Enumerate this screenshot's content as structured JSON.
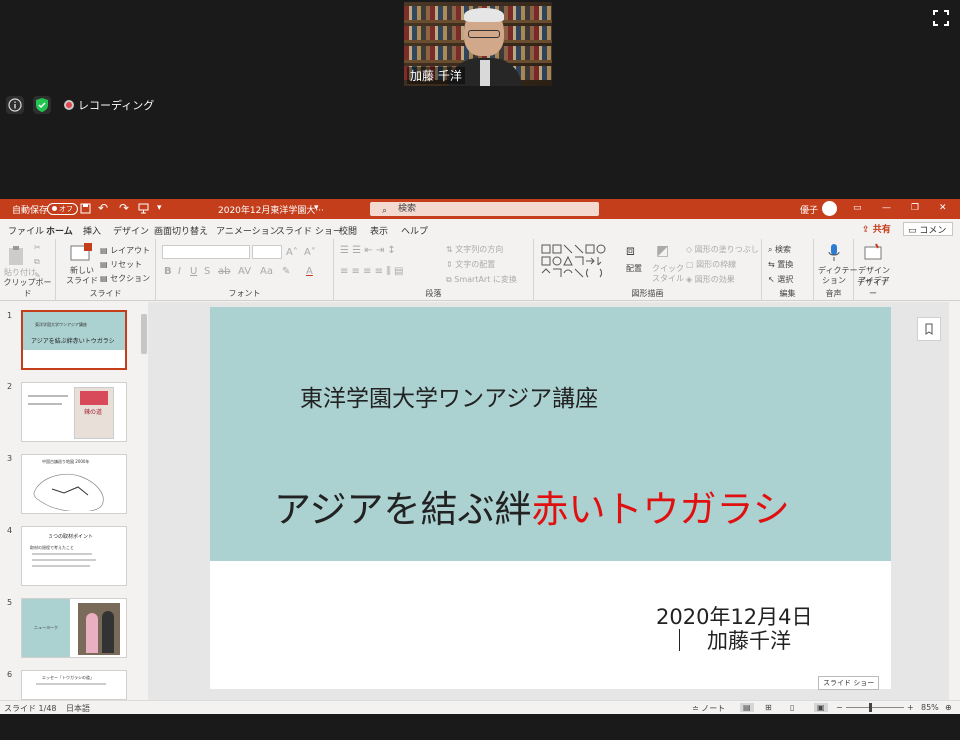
{
  "zoom": {
    "participant_name": "加藤 千洋",
    "recording_label": "レコーディング"
  },
  "titlebar": {
    "autosave_label": "自動保存",
    "autosave_toggle": "オフ",
    "document_title": "2020年12月東洋学園大···",
    "search_placeholder": "検索",
    "user_name": "優子"
  },
  "tabs": [
    "ファイル",
    "ホーム",
    "挿入",
    "デザイン",
    "画面切り替え",
    "アニメーション",
    "スライド ショー",
    "校閲",
    "表示",
    "ヘルプ"
  ],
  "share_label": "共有",
  "comment_label": "コメント",
  "ribbon": {
    "clipboard": {
      "paste": "貼り付け",
      "label": "クリップボード"
    },
    "slides": {
      "new_slide_1": "新しい",
      "new_slide_2": "スライド",
      "layout": "レイアウト",
      "reset": "リセット",
      "section": "セクション",
      "label": "スライド"
    },
    "font": {
      "label": "フォント"
    },
    "paragraph": {
      "text_direction": "文字列の方向",
      "align_text": "文字の配置",
      "smartart": "SmartArt に変換",
      "label": "段落"
    },
    "drawing": {
      "arrange": "配置",
      "quick_style_1": "クイック",
      "quick_style_2": "スタイル",
      "fill": "図形の塗りつぶし",
      "outline": "図形の枠線",
      "effects": "図形の効果",
      "label": "図形描画"
    },
    "editing": {
      "find": "検索",
      "replace": "置換",
      "select": "選択",
      "label": "編集"
    },
    "voice": {
      "dictate_1": "ディクテー",
      "dictate_2": "ション",
      "label": "音声"
    },
    "designer": {
      "ideas_1": "デザイン",
      "ideas_2": "アイデア",
      "label": "デザイナー"
    }
  },
  "thumbnails": [
    {
      "num": "1",
      "title": "アジアを結ぶ絆赤いトウガラシ",
      "line1": "東洋学園大学ワンアジア講座"
    },
    {
      "num": "2",
      "title": "辣の道"
    },
    {
      "num": "3",
      "title": "中国古鎮巡り地図 2000年"
    },
    {
      "num": "4",
      "title": "３つの取材ポイント",
      "line1": "取材の過程で考えたこと"
    },
    {
      "num": "5",
      "title": "ニューヨーク"
    },
    {
      "num": "6",
      "title": "エッセー「トウガラシの道」"
    }
  ],
  "slide": {
    "subtitle": "東洋学園大学ワンアジア講座",
    "title_black": "アジアを結ぶ絆",
    "title_red": "赤いトウガラシ",
    "date": "2020年12月4日",
    "name": "加藤千洋"
  },
  "tooltip": "スライド ショー",
  "status": {
    "slide_count": "スライド 1/48",
    "language": "日本語",
    "notes": "ノート",
    "zoom": "85%"
  }
}
